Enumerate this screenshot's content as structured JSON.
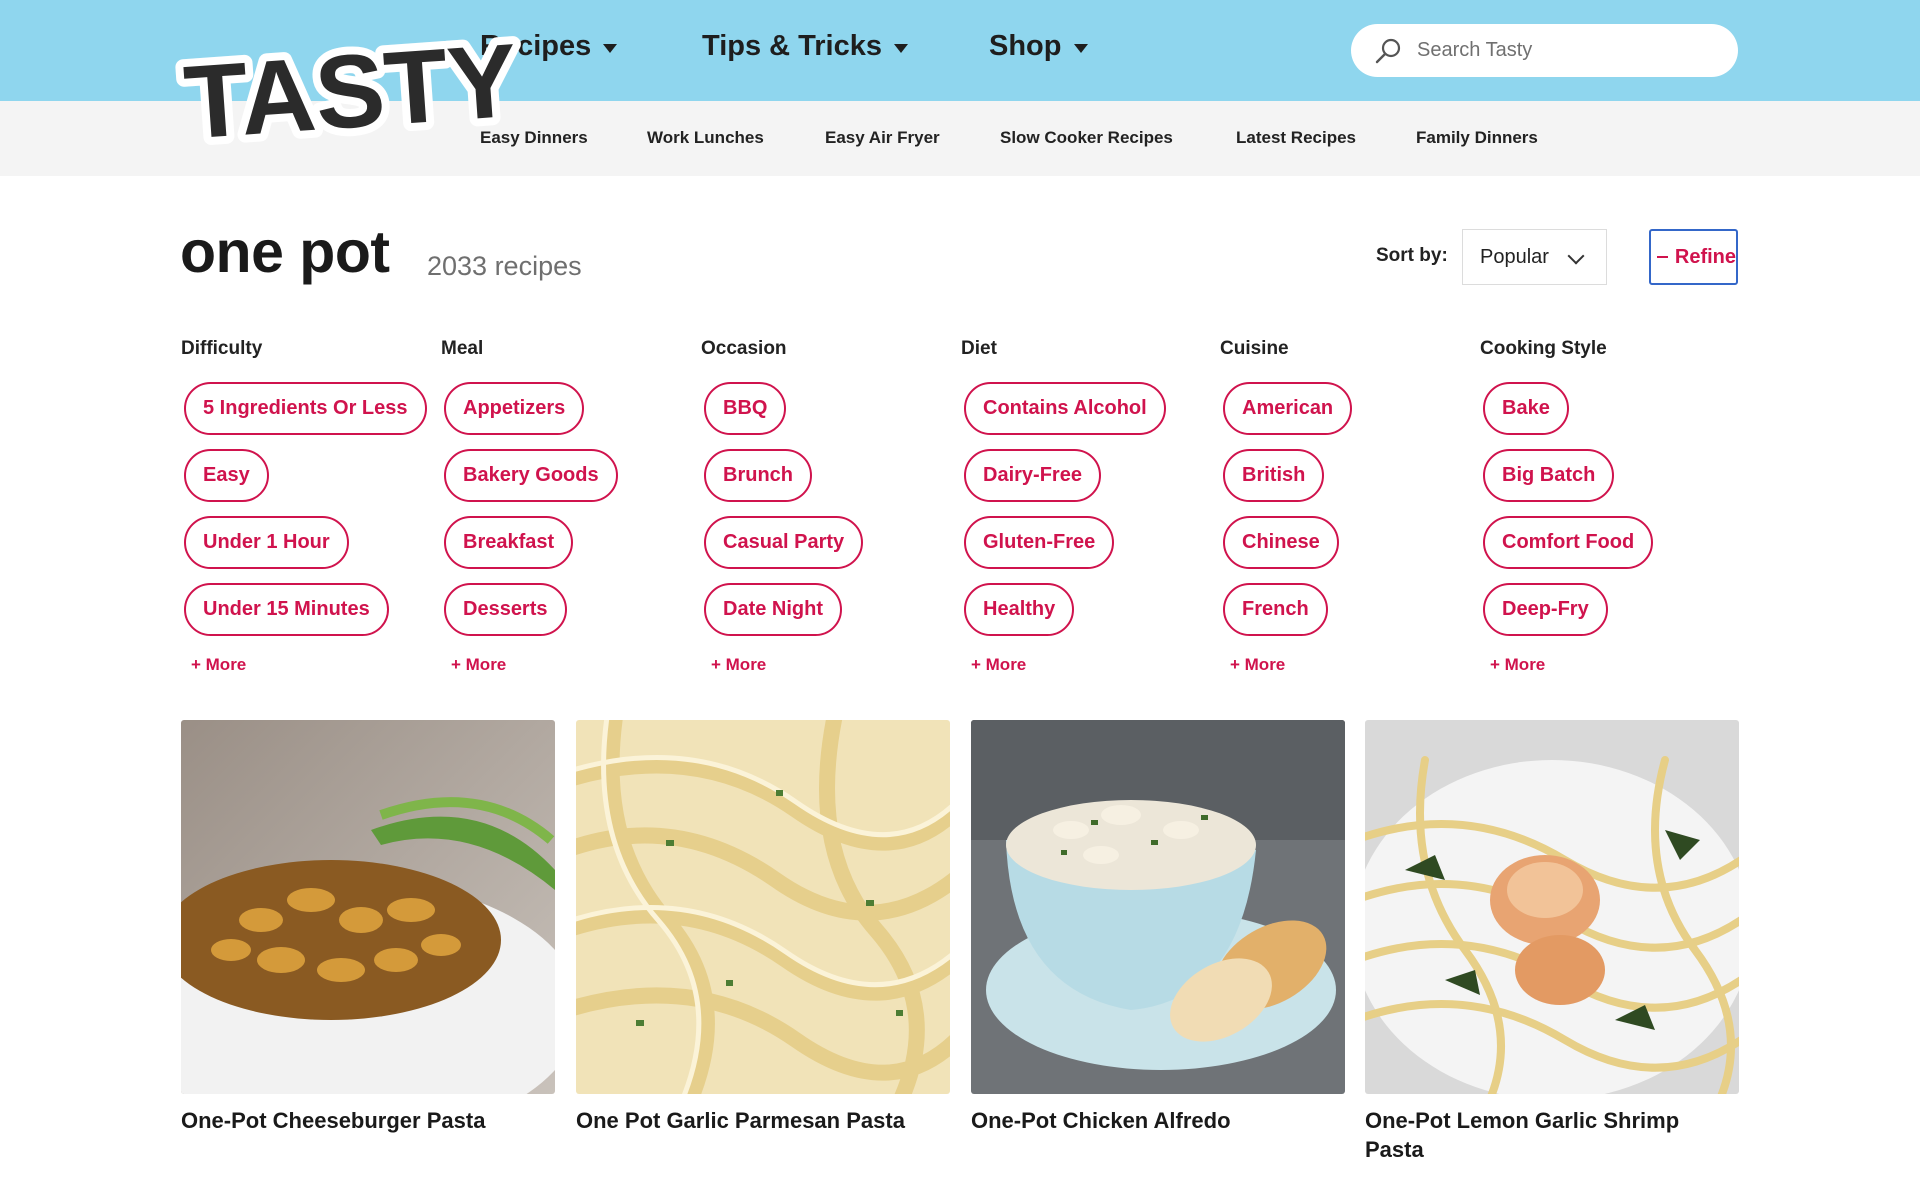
{
  "brand": {
    "logo_text": "TASTY"
  },
  "main_nav": [
    {
      "label": "Recipes"
    },
    {
      "label": "Tips & Tricks"
    },
    {
      "label": "Shop"
    }
  ],
  "search": {
    "placeholder": "Search Tasty",
    "value": ""
  },
  "sub_nav": [
    "Easy Dinners",
    "Work Lunches",
    "Easy Air Fryer",
    "Slow Cooker Recipes",
    "Latest Recipes",
    "Family Dinners"
  ],
  "page": {
    "title": "one pot",
    "count": "2033 recipes"
  },
  "sort": {
    "label": "Sort by:",
    "value": "Popular"
  },
  "refine": {
    "label": "Refine"
  },
  "filters": [
    {
      "heading": "Difficulty",
      "chips": [
        "5 Ingredients Or Less",
        "Easy",
        "Under 1 Hour",
        "Under 15 Minutes"
      ],
      "more": "+ More"
    },
    {
      "heading": "Meal",
      "chips": [
        "Appetizers",
        "Bakery Goods",
        "Breakfast",
        "Desserts"
      ],
      "more": "+ More"
    },
    {
      "heading": "Occasion",
      "chips": [
        "BBQ",
        "Brunch",
        "Casual Party",
        "Date Night"
      ],
      "more": "+ More"
    },
    {
      "heading": "Diet",
      "chips": [
        "Contains Alcohol",
        "Dairy-Free",
        "Gluten-Free",
        "Healthy"
      ],
      "more": "+ More"
    },
    {
      "heading": "Cuisine",
      "chips": [
        "American",
        "British",
        "Chinese",
        "French"
      ],
      "more": "+ More"
    },
    {
      "heading": "Cooking Style",
      "chips": [
        "Bake",
        "Big Batch",
        "Comfort Food",
        "Deep-Fry"
      ],
      "more": "+ More"
    }
  ],
  "recipes": [
    {
      "title": "One-Pot Cheeseburger Pasta"
    },
    {
      "title": "One Pot Garlic Parmesan Pasta"
    },
    {
      "title": "One-Pot Chicken Alfredo"
    },
    {
      "title": "One-Pot Lemon Garlic Shrimp Pasta"
    }
  ],
  "colors": {
    "header": "#8fd6ee",
    "subheader": "#f4f4f4",
    "accent": "#d0134d",
    "refine_border": "#3467c9"
  }
}
